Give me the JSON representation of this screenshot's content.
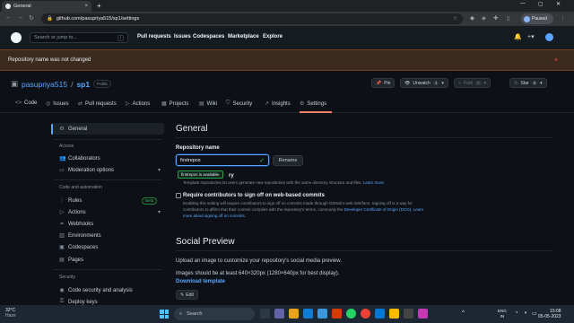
{
  "browser": {
    "tab_title": "General",
    "tab_close": "×",
    "new_tab": "+",
    "win_min": "—",
    "win_max": "▢",
    "win_close": "✕",
    "url": "github.com/pasupriya515/sp1/settings",
    "profile_label": "Paused"
  },
  "header": {
    "search_placeholder": "Search or jump to...",
    "search_shortcut": "/",
    "nav": [
      "Pull requests",
      "Issues",
      "Codespaces",
      "Marketplace",
      "Explore"
    ],
    "bell": "🔔",
    "plus": "+▾"
  },
  "flash": {
    "message": "Repository name was not changed",
    "close": "×"
  },
  "repo": {
    "owner": "pasupriya515",
    "sep": "/",
    "name": "sp1",
    "visibility": "Public",
    "pin": "Pin",
    "unwatch": "Unwatch",
    "unwatch_count": "1",
    "fork": "Fork",
    "fork_count": "0",
    "star": "Star",
    "star_count": "0"
  },
  "tabs": [
    "Code",
    "Issues",
    "Pull requests",
    "Actions",
    "Projects",
    "Wiki",
    "Security",
    "Insights",
    "Settings"
  ],
  "sidebar": {
    "general": "General",
    "access_heading": "Access",
    "collaborators": "Collaborators",
    "moderation": "Moderation options",
    "code_heading": "Code and automation",
    "rules": "Rules",
    "beta": "Beta",
    "actions": "Actions",
    "webhooks": "Webhooks",
    "environments": "Environments",
    "codespaces": "Codespaces",
    "pages": "Pages",
    "security_heading": "Security",
    "code_security": "Code security and analysis",
    "deploy_keys": "Deploy keys"
  },
  "main": {
    "title": "General",
    "repo_name_label": "Repository name",
    "repo_name_value": "firstrepos",
    "rename": "Rename",
    "available_tip": "firstrepos is available.",
    "template_suffix": "ry",
    "template_desc": "Template repositories let users generate new repositories with the same directory structure and files.",
    "learn_more": "Learn more.",
    "signoff_label": "Require contributors to sign off on web-based commits",
    "signoff_desc1": "Enabling this setting will require contributors to sign off on commits made through GitHub's web interface. Signing off is a way for",
    "signoff_desc2": "contributors to affirm that their commit complies with the repository's terms, commonly the",
    "signoff_link1": "Developer Certificate of Origin (DCO). Learn",
    "signoff_link2": "more about signing off on commits.",
    "social_title": "Social Preview",
    "social_desc": "Upload an image to customize your repository's social media preview.",
    "social_size": "Images should be at least 640×320px (1280×640px for best display).",
    "download": "Download template",
    "edit": "Edit"
  },
  "taskbar": {
    "temp": "32°C",
    "weather": "Haze",
    "search": "Search",
    "lang1": "ENG",
    "lang2": "IN",
    "time": "15:08",
    "date": "05-05-2023"
  },
  "colors": {
    "accent": "#58a6ff",
    "tab_underline": "#f78166",
    "flash_bg": "#3c2a1e",
    "success": "#3fb950"
  }
}
